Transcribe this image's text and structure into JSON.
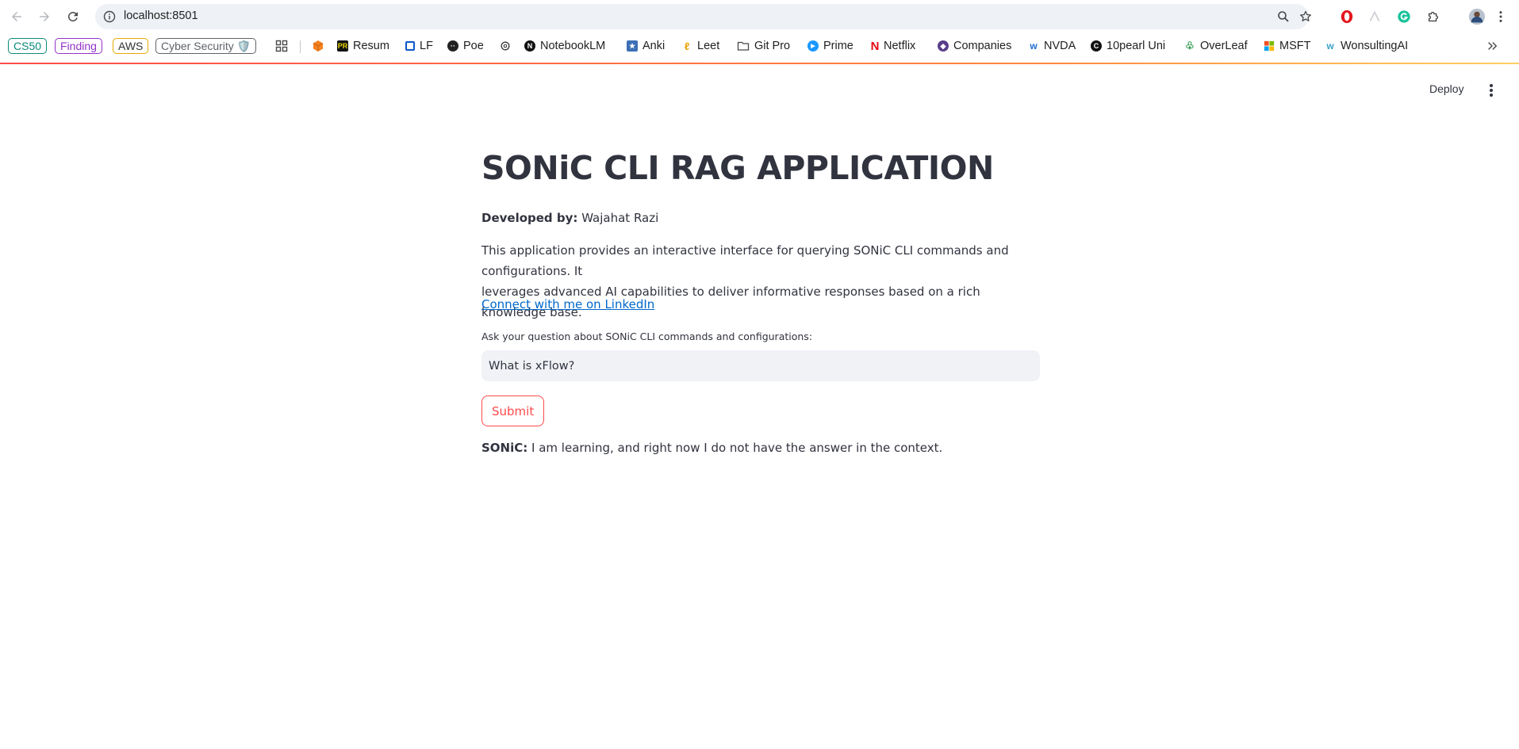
{
  "browser": {
    "url": "localhost:8501",
    "bookmarks": {
      "chips": [
        {
          "label": "CS50",
          "color": "#0b8a7a"
        },
        {
          "label": "Finding",
          "color": "#9333c9"
        },
        {
          "label": "AWS",
          "color": "#e8a800"
        },
        {
          "label": "Cyber Security 🛡️",
          "color": "#5f6368"
        }
      ],
      "items": [
        "Resum",
        "LF",
        "Poe",
        "NotebookLM",
        "Anki",
        "Leet",
        "Git Pro",
        "Prime",
        "Netflix",
        "Companies",
        "NVDA",
        "10pearl Uni",
        "OverLeaf",
        "MSFT",
        "WonsultingAI"
      ]
    }
  },
  "app": {
    "deploy_label": "Deploy",
    "title": "SONiC CLI RAG APPLICATION",
    "developed_by_label": "Developed by:",
    "developer_name": "Wajahat Razi",
    "description_line1": "This application provides an interactive interface for querying SONiC CLI commands and configurations. It",
    "description_line2": "leverages advanced AI capabilities to deliver informative responses based on a rich knowledge base.",
    "linkedin_link": "Connect with me on LinkedIn",
    "question_label": "Ask your question about SONiC CLI commands and configurations:",
    "question_value": "What is xFlow?",
    "submit_label": "Submit",
    "answer_label": "SONiC:",
    "answer_text": "I am learning, and right now I do not have the answer in the context."
  },
  "colors": {
    "accent": "#ff4b4b",
    "link": "#0068c9",
    "input_bg": "#f0f2f6",
    "text": "#31333f"
  }
}
